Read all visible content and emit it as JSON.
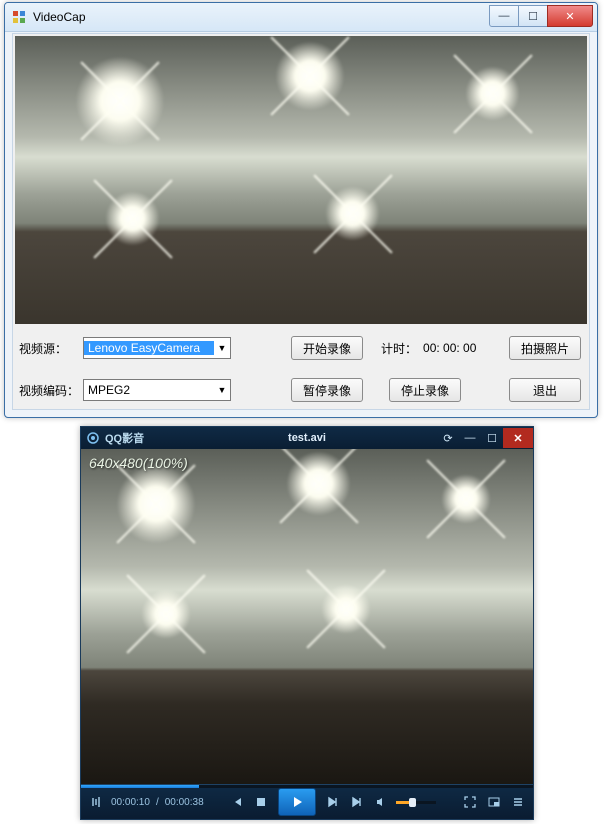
{
  "videocap": {
    "title": "VideoCap",
    "labels": {
      "source": "视频源：",
      "encoder": "视频编码：",
      "timer": "计时：",
      "timer_value": "00: 00: 00"
    },
    "combos": {
      "source_value": "Lenovo EasyCamera",
      "encoder_value": "MPEG2"
    },
    "buttons": {
      "start_record": "开始录像",
      "capture_photo": "拍摄照片",
      "pause_record": "暂停录像",
      "stop_record": "停止录像",
      "exit": "退出"
    },
    "window_controls": {
      "min": "—",
      "max": "☐",
      "close": "✕"
    }
  },
  "qqplayer": {
    "app_name": "QQ影音",
    "file": "test.avi",
    "resolution_overlay": "640x480(100%)",
    "time_current": "00:00:10",
    "time_total": "00:00:38",
    "window_controls": {
      "rotate": "⟳",
      "min": "—",
      "max": "☐",
      "close": "✕"
    }
  }
}
